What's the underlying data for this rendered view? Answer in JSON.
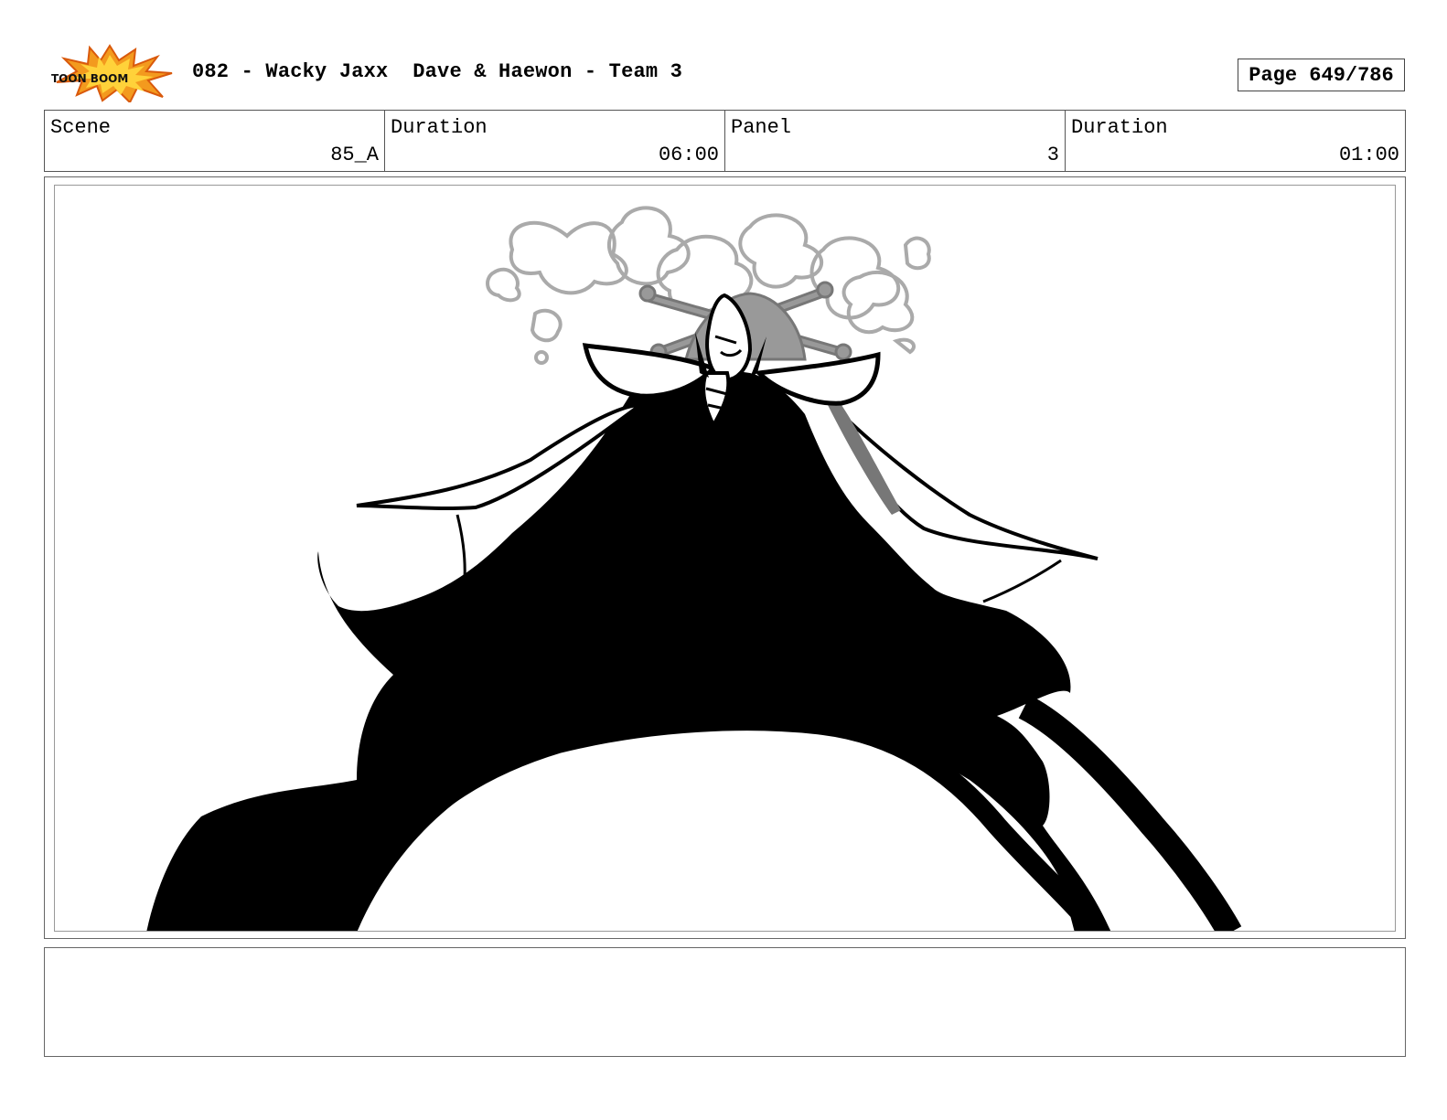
{
  "header": {
    "logo_text": "TOON BOOM",
    "title": "082 - Wacky Jaxx  Dave & Haewon - Team 3",
    "page_label": "Page 649/786"
  },
  "info": [
    {
      "label": "Scene",
      "value": "85_A"
    },
    {
      "label": "Duration",
      "value": "06:00"
    },
    {
      "label": "Panel",
      "value": "3"
    },
    {
      "label": "Duration",
      "value": "01:00"
    }
  ],
  "panel": {
    "illustration": "caped-villain-sketch"
  },
  "notes": {
    "text": ""
  }
}
